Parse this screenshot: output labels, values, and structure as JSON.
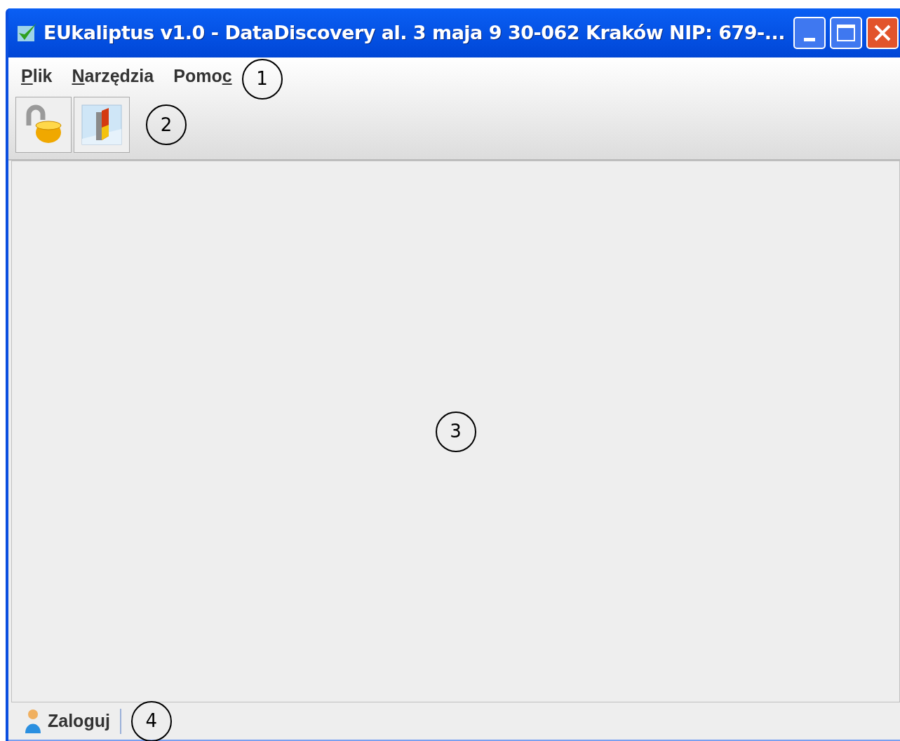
{
  "window": {
    "title": "EUkaliptus v1.0 - DataDiscovery al. 3 maja 9 30-062 Kraków NIP: 679-..."
  },
  "menubar": {
    "items": [
      {
        "segments": [
          {
            "text": "P",
            "underlined": true
          },
          {
            "text": "lik",
            "underlined": false
          }
        ]
      },
      {
        "segments": [
          {
            "text": "N",
            "underlined": true
          },
          {
            "text": "arzędzia",
            "underlined": false
          }
        ]
      },
      {
        "segments": [
          {
            "text": "Pomo",
            "underlined": false
          },
          {
            "text": "c",
            "underlined": true
          }
        ]
      }
    ],
    "callout": "1"
  },
  "toolbar": {
    "buttons": [
      {
        "kind": "unlock"
      },
      {
        "kind": "exit"
      }
    ],
    "callout": "2"
  },
  "content": {
    "callout": "3"
  },
  "status_bar": {
    "label": "Zaloguj",
    "callout": "4"
  }
}
